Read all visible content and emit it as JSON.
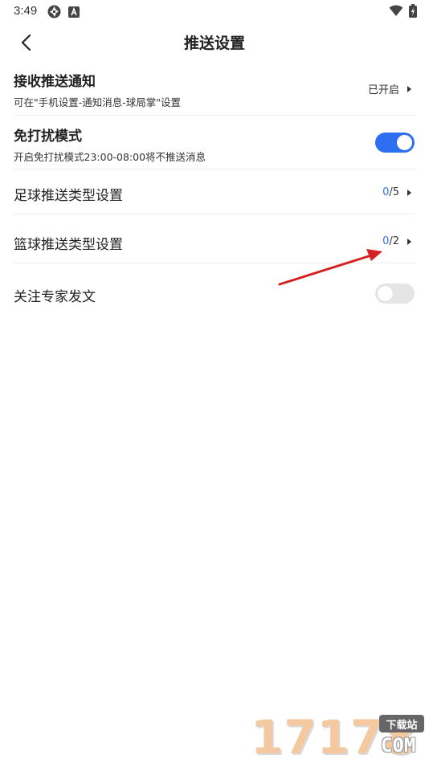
{
  "status_bar": {
    "time": "3:49",
    "left_icons": [
      "aperture-icon",
      "a-box-icon"
    ],
    "right_icons": [
      "wifi-icon",
      "battery-charging-icon"
    ]
  },
  "header": {
    "title": "推送设置",
    "back_icon": "chevron-left-icon"
  },
  "settings": {
    "receive_push": {
      "title": "接收推送通知",
      "subtitle": "可在\"手机设置-通知消息-球局掌\"设置",
      "status": "已开启"
    },
    "dnd_mode": {
      "title": "免打扰模式",
      "subtitle": "开启免打扰模式23:00-08:00将不推送消息",
      "enabled": true
    },
    "football_types": {
      "title": "足球推送类型设置",
      "selected": "0",
      "total": "/5"
    },
    "basketball_types": {
      "title": "篮球推送类型设置",
      "selected": "0",
      "total": "/2"
    },
    "expert_posts": {
      "title": "关注专家发文",
      "enabled": false
    }
  },
  "annotation": {
    "arrow_color": "#d42222"
  },
  "colors": {
    "accent": "#2e6ff1",
    "toggle_off": "#e5e5e5",
    "divider": "#eeeeee"
  },
  "watermark": {
    "number": "17178",
    "tag": "下载站",
    "domain": "COM"
  }
}
